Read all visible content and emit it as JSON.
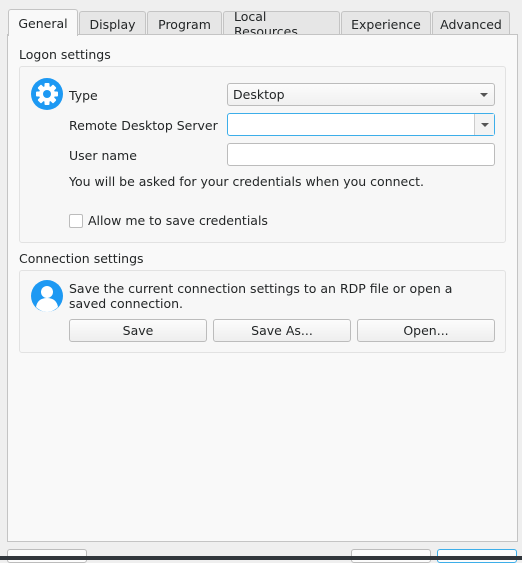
{
  "tabs": [
    {
      "label": "General",
      "active": true
    },
    {
      "label": "Display"
    },
    {
      "label": "Program"
    },
    {
      "label": "Local Resources"
    },
    {
      "label": "Experience"
    },
    {
      "label": "Advanced"
    }
  ],
  "logon": {
    "title": "Logon settings",
    "icon": "gear-icon",
    "type_label": "Type",
    "type_value": "Desktop",
    "server_label": "Remote Desktop Server",
    "server_value": "",
    "username_label": "User name",
    "username_value": "",
    "info": "You will be asked for your credentials when you connect.",
    "allow_save_label": "Allow me to save credentials",
    "allow_save_checked": false
  },
  "connection": {
    "title": "Connection settings",
    "icon": "user-icon",
    "description": "Save the current connection settings to an RDP file or open a saved connection.",
    "save": "Save",
    "save_as": "Save As...",
    "open": "Open..."
  },
  "colors": {
    "accent": "#3daee9",
    "icon_blue": "#1d99f3"
  }
}
